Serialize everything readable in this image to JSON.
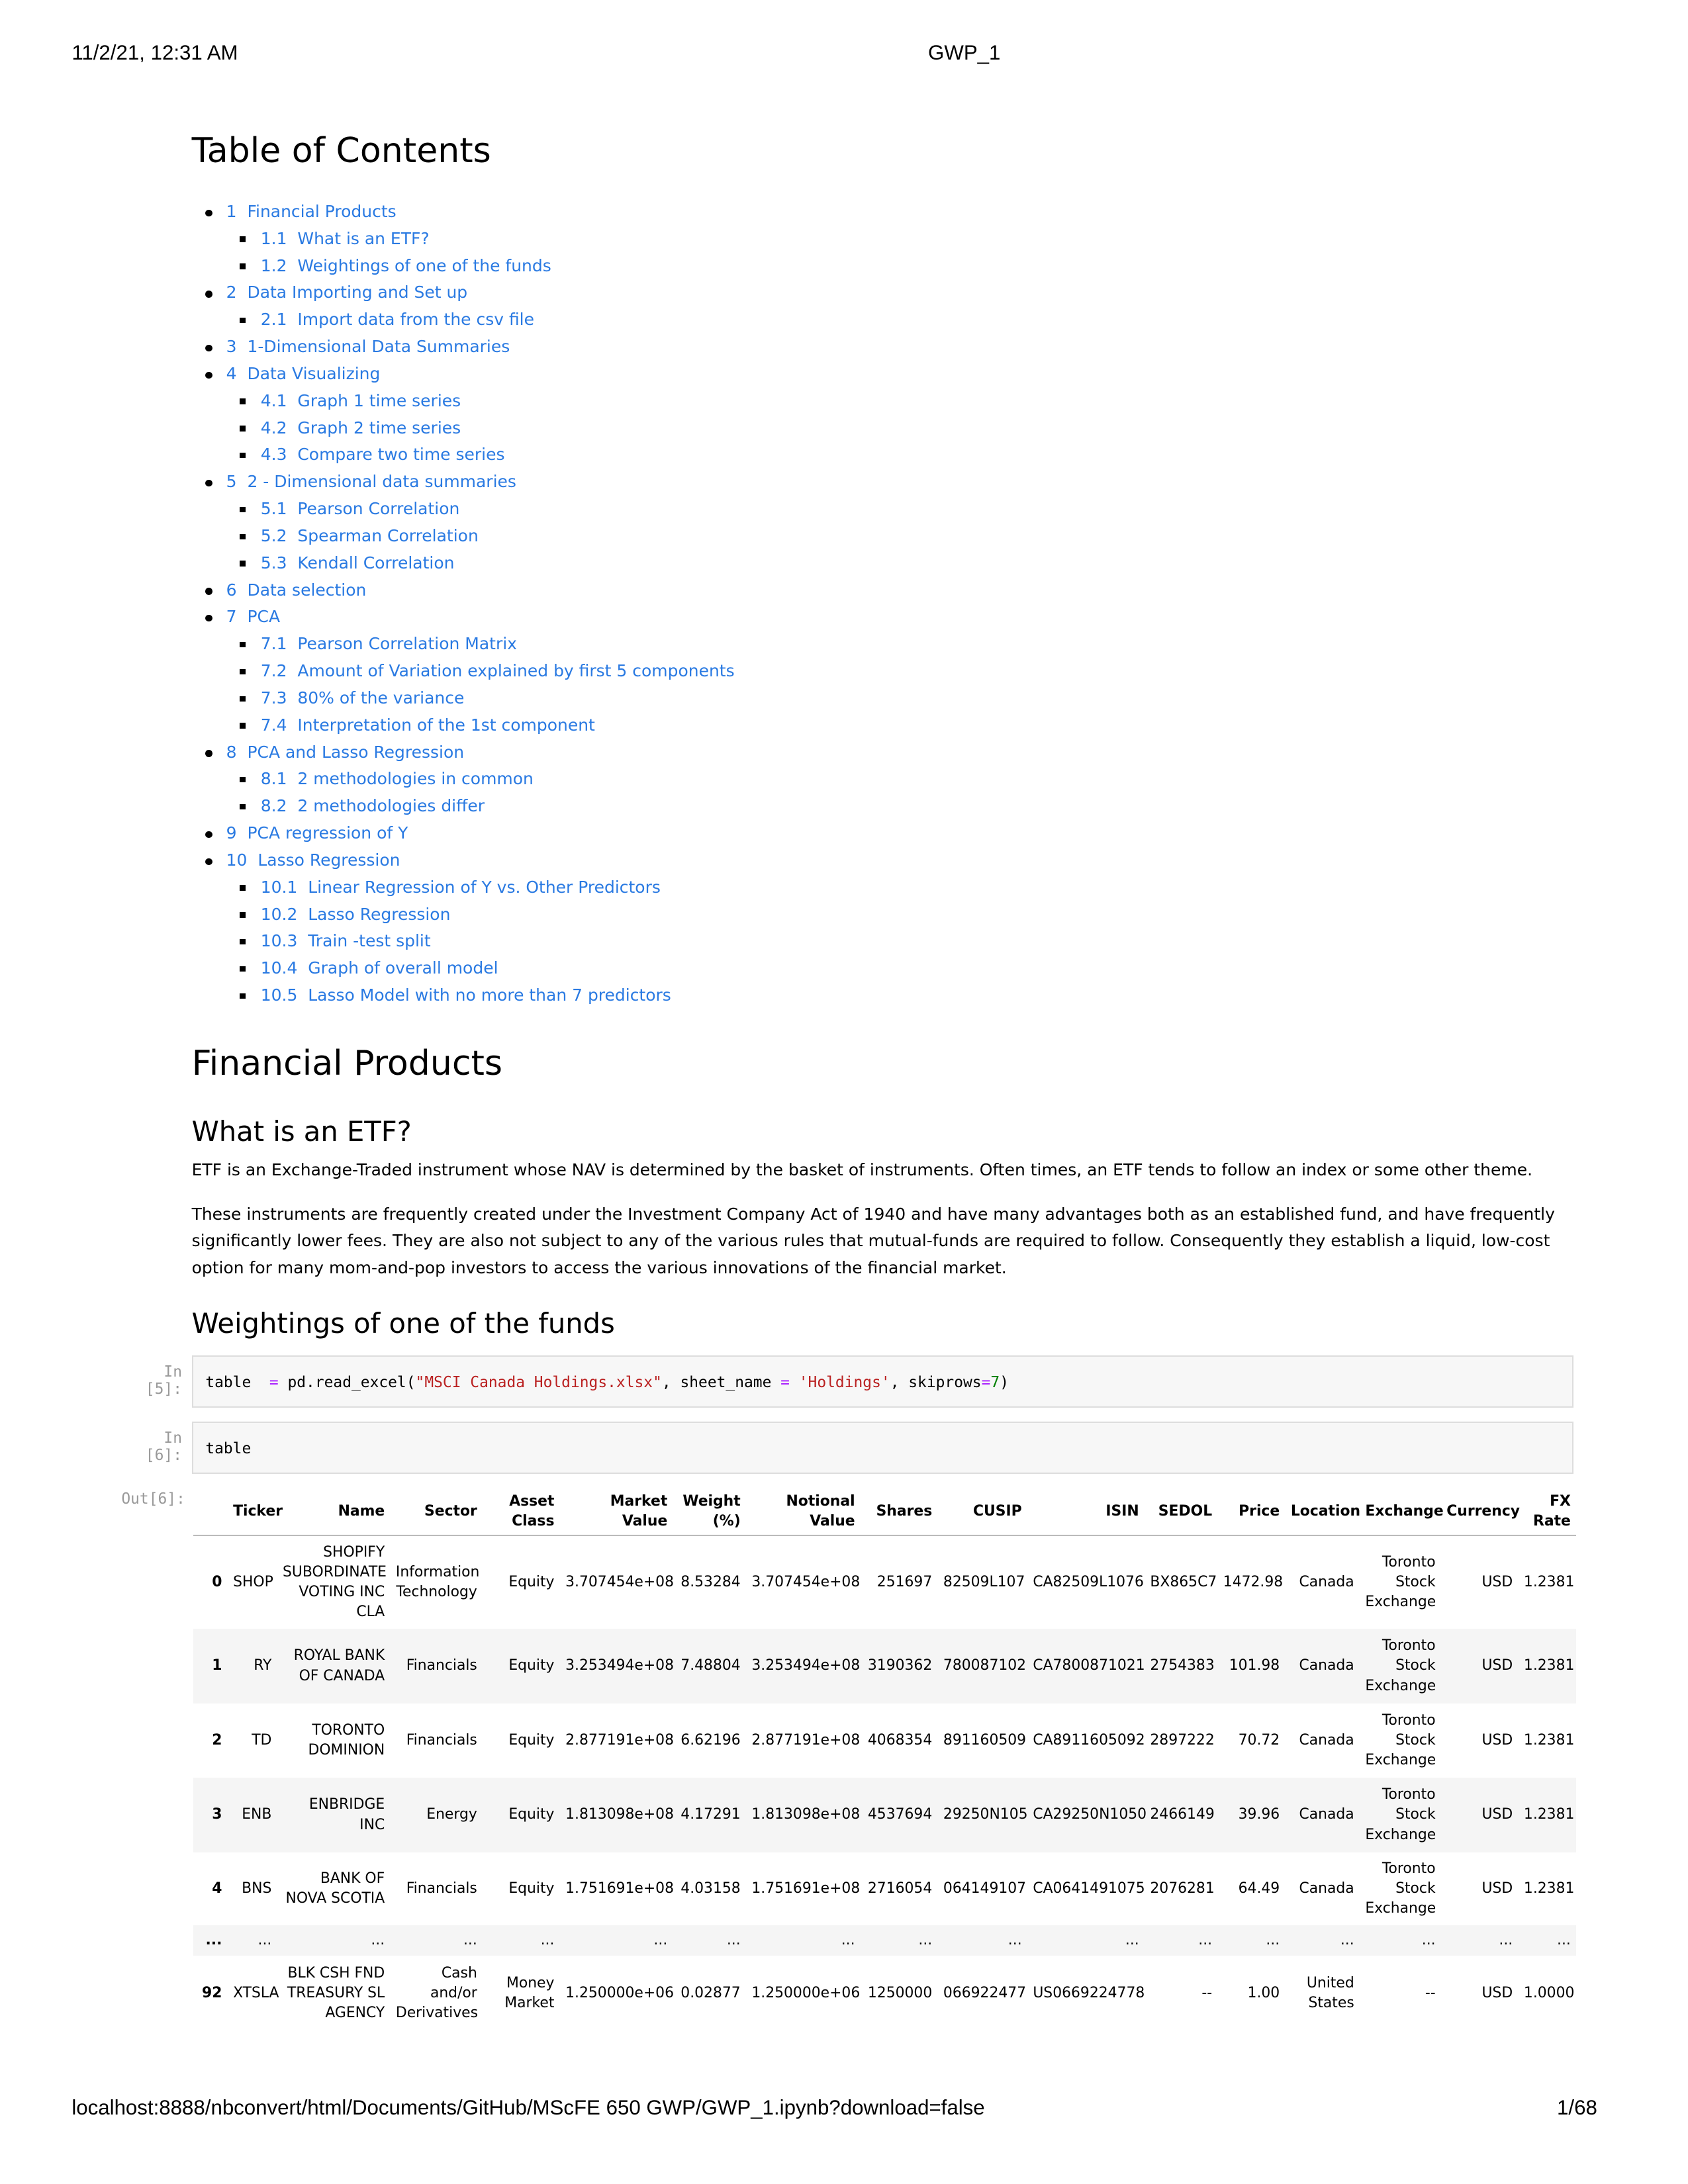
{
  "print_header": {
    "datetime": "11/2/21, 12:31 AM",
    "title": "GWP_1"
  },
  "print_footer": {
    "url": "localhost:8888/nbconvert/html/Documents/GitHub/MScFE 650 GWP/GWP_1.ipynb?download=false",
    "page": "1/68"
  },
  "toc": {
    "title": "Table of Contents",
    "items": [
      {
        "level": 1,
        "num": "1",
        "label": "Financial Products"
      },
      {
        "level": 2,
        "num": "1.1",
        "label": "What is an ETF?"
      },
      {
        "level": 2,
        "num": "1.2",
        "label": "Weightings of one of the funds"
      },
      {
        "level": 1,
        "num": "2",
        "label": "Data Importing and Set up"
      },
      {
        "level": 2,
        "num": "2.1",
        "label": "Import data from the csv file"
      },
      {
        "level": 1,
        "num": "3",
        "label": "1-Dimensional Data Summaries"
      },
      {
        "level": 1,
        "num": "4",
        "label": "Data Visualizing"
      },
      {
        "level": 2,
        "num": "4.1",
        "label": "Graph 1 time series"
      },
      {
        "level": 2,
        "num": "4.2",
        "label": "Graph 2 time series"
      },
      {
        "level": 2,
        "num": "4.3",
        "label": "Compare two time series"
      },
      {
        "level": 1,
        "num": "5",
        "label": "2 - Dimensional data summaries"
      },
      {
        "level": 2,
        "num": "5.1",
        "label": "Pearson Correlation"
      },
      {
        "level": 2,
        "num": "5.2",
        "label": "Spearman Correlation"
      },
      {
        "level": 2,
        "num": "5.3",
        "label": "Kendall Correlation"
      },
      {
        "level": 1,
        "num": "6",
        "label": "Data selection"
      },
      {
        "level": 1,
        "num": "7",
        "label": "PCA"
      },
      {
        "level": 2,
        "num": "7.1",
        "label": "Pearson Correlation Matrix"
      },
      {
        "level": 2,
        "num": "7.2",
        "label": "Amount of Variation explained by first 5 components"
      },
      {
        "level": 2,
        "num": "7.3",
        "label": "80% of the variance"
      },
      {
        "level": 2,
        "num": "7.4",
        "label": "Interpretation of the 1st component"
      },
      {
        "level": 1,
        "num": "8",
        "label": "PCA and Lasso Regression"
      },
      {
        "level": 2,
        "num": "8.1",
        "label": "2 methodologies in common"
      },
      {
        "level": 2,
        "num": "8.2",
        "label": "2 methodologies differ"
      },
      {
        "level": 1,
        "num": "9",
        "label": "PCA regression of Y"
      },
      {
        "level": 1,
        "num": "10",
        "label": "Lasso Regression"
      },
      {
        "level": 2,
        "num": "10.1",
        "label": "Linear Regression of Y vs. Other Predictors"
      },
      {
        "level": 2,
        "num": "10.2",
        "label": "Lasso Regression"
      },
      {
        "level": 2,
        "num": "10.3",
        "label": "Train -test split"
      },
      {
        "level": 2,
        "num": "10.4",
        "label": "Graph of overall model"
      },
      {
        "level": 2,
        "num": "10.5",
        "label": "Lasso Model with no more than 7 predictors"
      }
    ]
  },
  "section": {
    "h1": "Financial Products",
    "h2_etf": "What is an ETF?",
    "para1": "ETF is an Exchange-Traded instrument whose NAV is determined by the basket of instruments. Often times, an ETF tends to follow an index or some other theme.",
    "para2": "These instruments are frequently created under the Investment Company Act of 1940 and have many advantages both as an established fund, and have frequently significantly lower fees. They are also not subject to any of the various rules that mutual-funds are required to follow. Consequently they establish a liquid, low-cost option for many mom-and-pop investors to access the various innovations of the financial market.",
    "h2_weight": "Weightings of one of the funds"
  },
  "cells": {
    "in5": {
      "prompt": "In [5]:",
      "code_parts": [
        "table  ",
        "=",
        " pd.read_excel(",
        "\"MSCI Canada Holdings.xlsx\"",
        ", sheet_name ",
        "=",
        " ",
        "'Holdings'",
        ", skiprows",
        "=",
        "7",
        ")"
      ]
    },
    "in6": {
      "prompt": "In [6]:",
      "code": "table"
    },
    "out6": {
      "prompt": "Out[6]:"
    }
  },
  "table": {
    "columns": [
      "",
      "Ticker",
      "Name",
      "Sector",
      "Asset Class",
      "Market Value",
      "Weight (%)",
      "Notional Value",
      "Shares",
      "CUSIP",
      "ISIN",
      "SEDOL",
      "Price",
      "Location",
      "Exchange",
      "Currency",
      "FX Rate"
    ],
    "rows": [
      [
        "0",
        "SHOP",
        "SHOPIFY SUBORDINATE VOTING INC CLA",
        "Information Technology",
        "Equity",
        "3.707454e+08",
        "8.53284",
        "3.707454e+08",
        "251697",
        "82509L107",
        "CA82509L1076",
        "BX865C7",
        "1472.98",
        "Canada",
        "Toronto Stock Exchange",
        "USD",
        "1.2381"
      ],
      [
        "1",
        "RY",
        "ROYAL BANK OF CANADA",
        "Financials",
        "Equity",
        "3.253494e+08",
        "7.48804",
        "3.253494e+08",
        "3190362",
        "780087102",
        "CA7800871021",
        "2754383",
        "101.98",
        "Canada",
        "Toronto Stock Exchange",
        "USD",
        "1.2381"
      ],
      [
        "2",
        "TD",
        "TORONTO DOMINION",
        "Financials",
        "Equity",
        "2.877191e+08",
        "6.62196",
        "2.877191e+08",
        "4068354",
        "891160509",
        "CA8911605092",
        "2897222",
        "70.72",
        "Canada",
        "Toronto Stock Exchange",
        "USD",
        "1.2381"
      ],
      [
        "3",
        "ENB",
        "ENBRIDGE INC",
        "Energy",
        "Equity",
        "1.813098e+08",
        "4.17291",
        "1.813098e+08",
        "4537694",
        "29250N105",
        "CA29250N1050",
        "2466149",
        "39.96",
        "Canada",
        "Toronto Stock Exchange",
        "USD",
        "1.2381"
      ],
      [
        "4",
        "BNS",
        "BANK OF NOVA SCOTIA",
        "Financials",
        "Equity",
        "1.751691e+08",
        "4.03158",
        "1.751691e+08",
        "2716054",
        "064149107",
        "CA0641491075",
        "2076281",
        "64.49",
        "Canada",
        "Toronto Stock Exchange",
        "USD",
        "1.2381"
      ],
      [
        "...",
        "...",
        "...",
        "...",
        "...",
        "...",
        "...",
        "...",
        "...",
        "...",
        "...",
        "...",
        "...",
        "...",
        "...",
        "...",
        "..."
      ],
      [
        "92",
        "XTSLA",
        "BLK CSH FND TREASURY SL AGENCY",
        "Cash and/or Derivatives",
        "Money Market",
        "1.250000e+06",
        "0.02877",
        "1.250000e+06",
        "1250000",
        "066922477",
        "US0669224778",
        "--",
        "1.00",
        "United States",
        "--",
        "USD",
        "1.0000"
      ]
    ]
  }
}
